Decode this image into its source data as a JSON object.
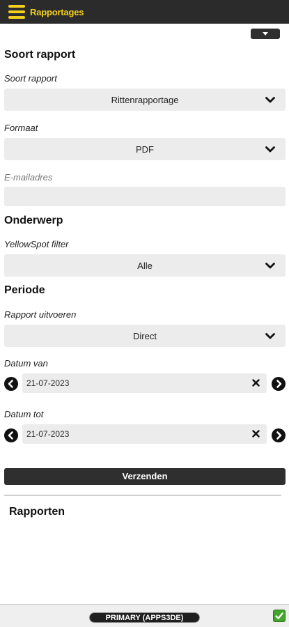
{
  "header": {
    "title": "Rapportages"
  },
  "sections": {
    "report_type": "Soort rapport",
    "subject": "Onderwerp",
    "period": "Periode",
    "reports": "Rapporten"
  },
  "fields": {
    "report_type": {
      "label": "Soort rapport",
      "value": "Rittenrapportage"
    },
    "format": {
      "label": "Formaat",
      "value": "PDF"
    },
    "email": {
      "label": "E-mailadres",
      "value": ""
    },
    "yellowspot": {
      "label": "YellowSpot filter",
      "value": "Alle"
    },
    "run": {
      "label": "Rapport uitvoeren",
      "value": "Direct"
    },
    "date_from": {
      "label": "Datum van",
      "value": "21-07-2023"
    },
    "date_to": {
      "label": "Datum tot",
      "value": "21-07-2023"
    }
  },
  "actions": {
    "submit": "Verzenden"
  },
  "footer": {
    "server": "PRIMARY (APPS3DE)",
    "status_color": "#43a52b"
  },
  "colors": {
    "accent": "#f2cf1d",
    "bar": "#2b2b2b"
  },
  "icons": [
    "menu-icon",
    "caret-down-icon",
    "chevron-down-icon",
    "arrow-left-icon",
    "arrow-right-icon",
    "clear-icon",
    "check-icon"
  ]
}
